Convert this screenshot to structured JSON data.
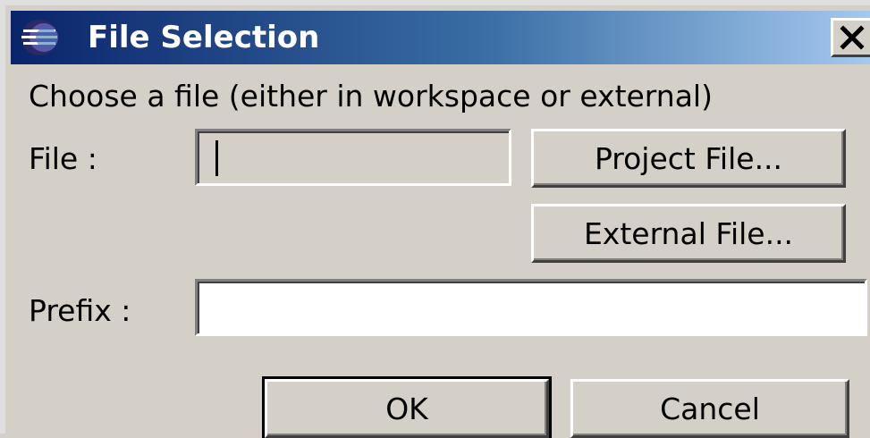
{
  "window": {
    "title": "File Selection",
    "close_symbol": "X"
  },
  "dialog": {
    "instruction": "Choose a file (either in workspace or external)",
    "file_label": "File :",
    "file_value": "",
    "prefix_label": "Prefix :",
    "prefix_value": "",
    "project_file_button": "Project File...",
    "external_file_button": "External File...",
    "ok_button": "OK",
    "cancel_button": "Cancel"
  },
  "icons": {
    "app_icon": "eclipse-icon",
    "close_icon": "close-icon"
  },
  "colors": {
    "titlebar_start": "#0a246a",
    "titlebar_end": "#a6caf0",
    "dialog_bg": "#d4d0c8"
  }
}
